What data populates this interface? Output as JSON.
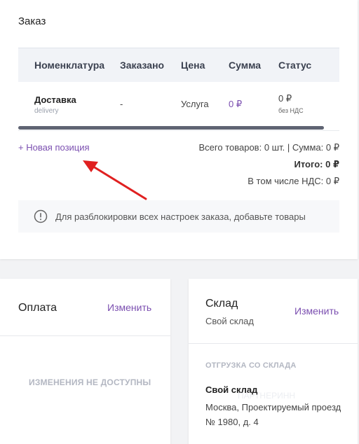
{
  "order": {
    "title": "Заказ",
    "table": {
      "headers": [
        "Номенклатура",
        "Заказано",
        "Цена",
        "Сумма",
        "Статус"
      ],
      "rows": [
        {
          "name": "Доставка",
          "subname": "delivery",
          "ordered": "-",
          "price": "Услуга",
          "sum": "0 ₽",
          "status": "0 ₽",
          "status_note": "без НДС"
        }
      ]
    },
    "new_position_label": "+ Новая позиция",
    "summary": {
      "totals_line": "Всего товаров: 0 шт. | Сумма: 0 ₽",
      "total_line": "Итого: 0 ₽",
      "vat_line": "В том числе НДС: 0 ₽"
    },
    "notice": "Для разблокировки всех настроек заказа, добавьте товары"
  },
  "payment": {
    "title": "Оплата",
    "edit_label": "Изменить",
    "unavailable": "ИЗМЕНЕНИЯ НЕ ДОСТУПНЫ"
  },
  "warehouse": {
    "title": "Склад",
    "subtitle": "Свой склад",
    "edit_label": "Изменить",
    "section_label": "ОТГРУЗКА СО СКЛАДА",
    "name": "Свой склад",
    "address": "Москва, Проектируемый проезд № 1980, д. 4",
    "watermark": "ПАРТНЕРИНН"
  },
  "colors": {
    "accent": "#7b4fb0",
    "arrow": "#e02020"
  }
}
